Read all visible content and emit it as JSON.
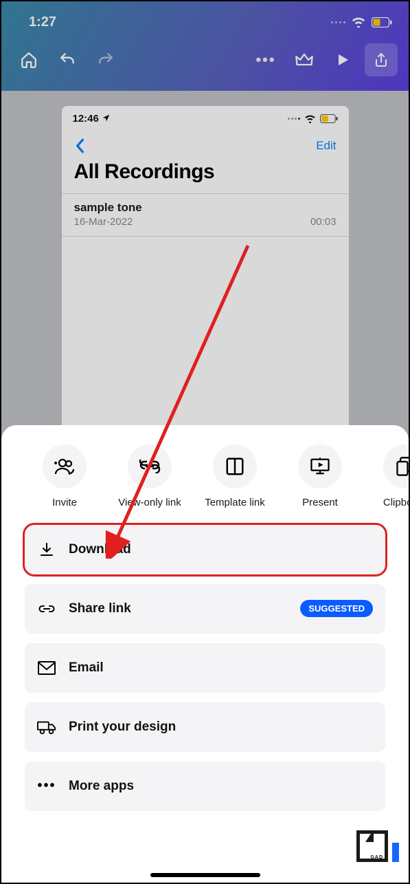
{
  "status": {
    "time": "1:27"
  },
  "canvas": {
    "status_time": "12:46",
    "edit": "Edit",
    "title": "All Recordings",
    "item": {
      "name": "sample tone",
      "date": "16-Mar-2022",
      "duration": "00:03"
    }
  },
  "share": {
    "icons": [
      {
        "key": "invite",
        "label": "Invite"
      },
      {
        "key": "viewonly",
        "label": "View-only link"
      },
      {
        "key": "template",
        "label": "Template link"
      },
      {
        "key": "present",
        "label": "Present"
      },
      {
        "key": "clipboard",
        "label": "Clipboard"
      }
    ],
    "rows": {
      "download": "Download",
      "sharelink": "Share link",
      "suggested": "SUGGESTED",
      "email": "Email",
      "print": "Print your design",
      "more": "More apps"
    }
  },
  "logo_text": "GAD"
}
